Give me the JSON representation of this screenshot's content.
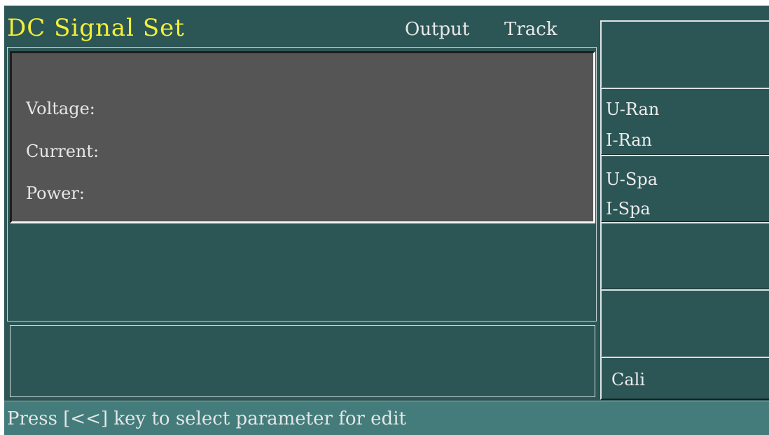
{
  "header": {
    "title": "DC Signal Set",
    "output_label": "Output",
    "track_label": "Track"
  },
  "display": {
    "voltage_label": "Voltage:",
    "current_label": "Current:",
    "power_label": "Power:"
  },
  "softkeys": {
    "u_range": "U-Ran",
    "i_range": "I-Ran",
    "u_span": "U-Spa",
    "i_span": "I-Spa",
    "cali": "Cali"
  },
  "status": {
    "hint": "Press [<<] key to select parameter for edit"
  },
  "colors": {
    "background": "#2c5655",
    "title": "#f2ef3a",
    "status_bar": "#437c7b",
    "display": "#555555"
  }
}
